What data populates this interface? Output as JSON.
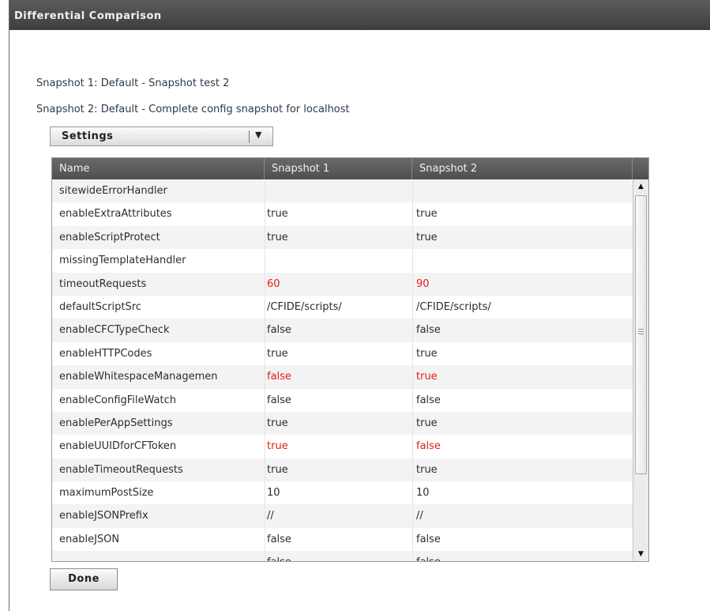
{
  "window": {
    "title": "Differential Comparison"
  },
  "snapshots": {
    "snapshot1": "Snapshot 1: Default - Snapshot test 2",
    "snapshot2": "Snapshot 2: Default - Complete config snapshot for localhost"
  },
  "category_select": {
    "selected": "Settings",
    "arrow_icon": "triangle-down-icon"
  },
  "grid": {
    "columns": [
      "Name",
      "Snapshot 1",
      "Snapshot 2"
    ],
    "diff_color": "#e0201a",
    "rows": [
      {
        "name": "sitewideErrorHandler",
        "s1": "",
        "s2": "",
        "diff": false
      },
      {
        "name": "enableExtraAttributes",
        "s1": "true",
        "s2": "true",
        "diff": false
      },
      {
        "name": "enableScriptProtect",
        "s1": "true",
        "s2": "true",
        "diff": false
      },
      {
        "name": "missingTemplateHandler",
        "s1": "",
        "s2": "",
        "diff": false
      },
      {
        "name": "timeoutRequests",
        "s1": "60",
        "s2": "90",
        "diff": true
      },
      {
        "name": "defaultScriptSrc",
        "s1": "/CFIDE/scripts/",
        "s2": "/CFIDE/scripts/",
        "diff": false
      },
      {
        "name": "enableCFCTypeCheck",
        "s1": "false",
        "s2": "false",
        "diff": false
      },
      {
        "name": "enableHTTPCodes",
        "s1": "true",
        "s2": "true",
        "diff": false
      },
      {
        "name": "enableWhitespaceManagemen",
        "s1": "false",
        "s2": "true",
        "diff": true
      },
      {
        "name": "enableConfigFileWatch",
        "s1": "false",
        "s2": "false",
        "diff": false
      },
      {
        "name": "enablePerAppSettings",
        "s1": "true",
        "s2": "true",
        "diff": false
      },
      {
        "name": "enableUUIDforCFToken",
        "s1": "true",
        "s2": "false",
        "diff": true
      },
      {
        "name": "enableTimeoutRequests",
        "s1": "true",
        "s2": "true",
        "diff": false
      },
      {
        "name": "maximumPostSize",
        "s1": "10",
        "s2": "10",
        "diff": false
      },
      {
        "name": "enableJSONPrefix",
        "s1": "//",
        "s2": "//",
        "diff": false
      },
      {
        "name": "enableJSON",
        "s1": "false",
        "s2": "false",
        "diff": false
      },
      {
        "name": "",
        "s1": "false",
        "s2": "false",
        "diff": false
      }
    ]
  },
  "scrollbar": {
    "up_icon": "scroll-up-arrow-icon",
    "down_icon": "scroll-down-arrow-icon",
    "grip_icon": "grip-lines-icon"
  },
  "actions": {
    "done_label": "Done"
  }
}
